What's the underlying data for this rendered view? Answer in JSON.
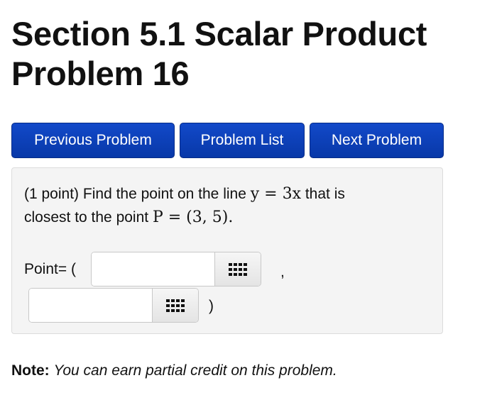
{
  "header": {
    "title_line1": "Section 5.1 Scalar Product",
    "title_line2": "Problem 16"
  },
  "nav": {
    "previous_label": "Previous Problem",
    "list_label": "Problem List",
    "next_label": "Next Problem"
  },
  "problem": {
    "points": "(1 point)",
    "text_before_eq": "Find the point on the line",
    "line_equation": "y = 3x",
    "text_after_eq": "that is",
    "text_line2": "closest to the point",
    "point_expr": "P = (3, 5).",
    "answer_label": "Point= (",
    "separator_comma": ",",
    "separator_close": ")",
    "answer1_value": "",
    "answer2_value": "",
    "palette_icon": "grid-icon"
  },
  "footer": {
    "note_label": "Note:",
    "note_text": "You can earn partial credit on this problem."
  },
  "colors": {
    "button_blue": "#0a3eb5",
    "panel_bg": "#f4f4f4"
  }
}
